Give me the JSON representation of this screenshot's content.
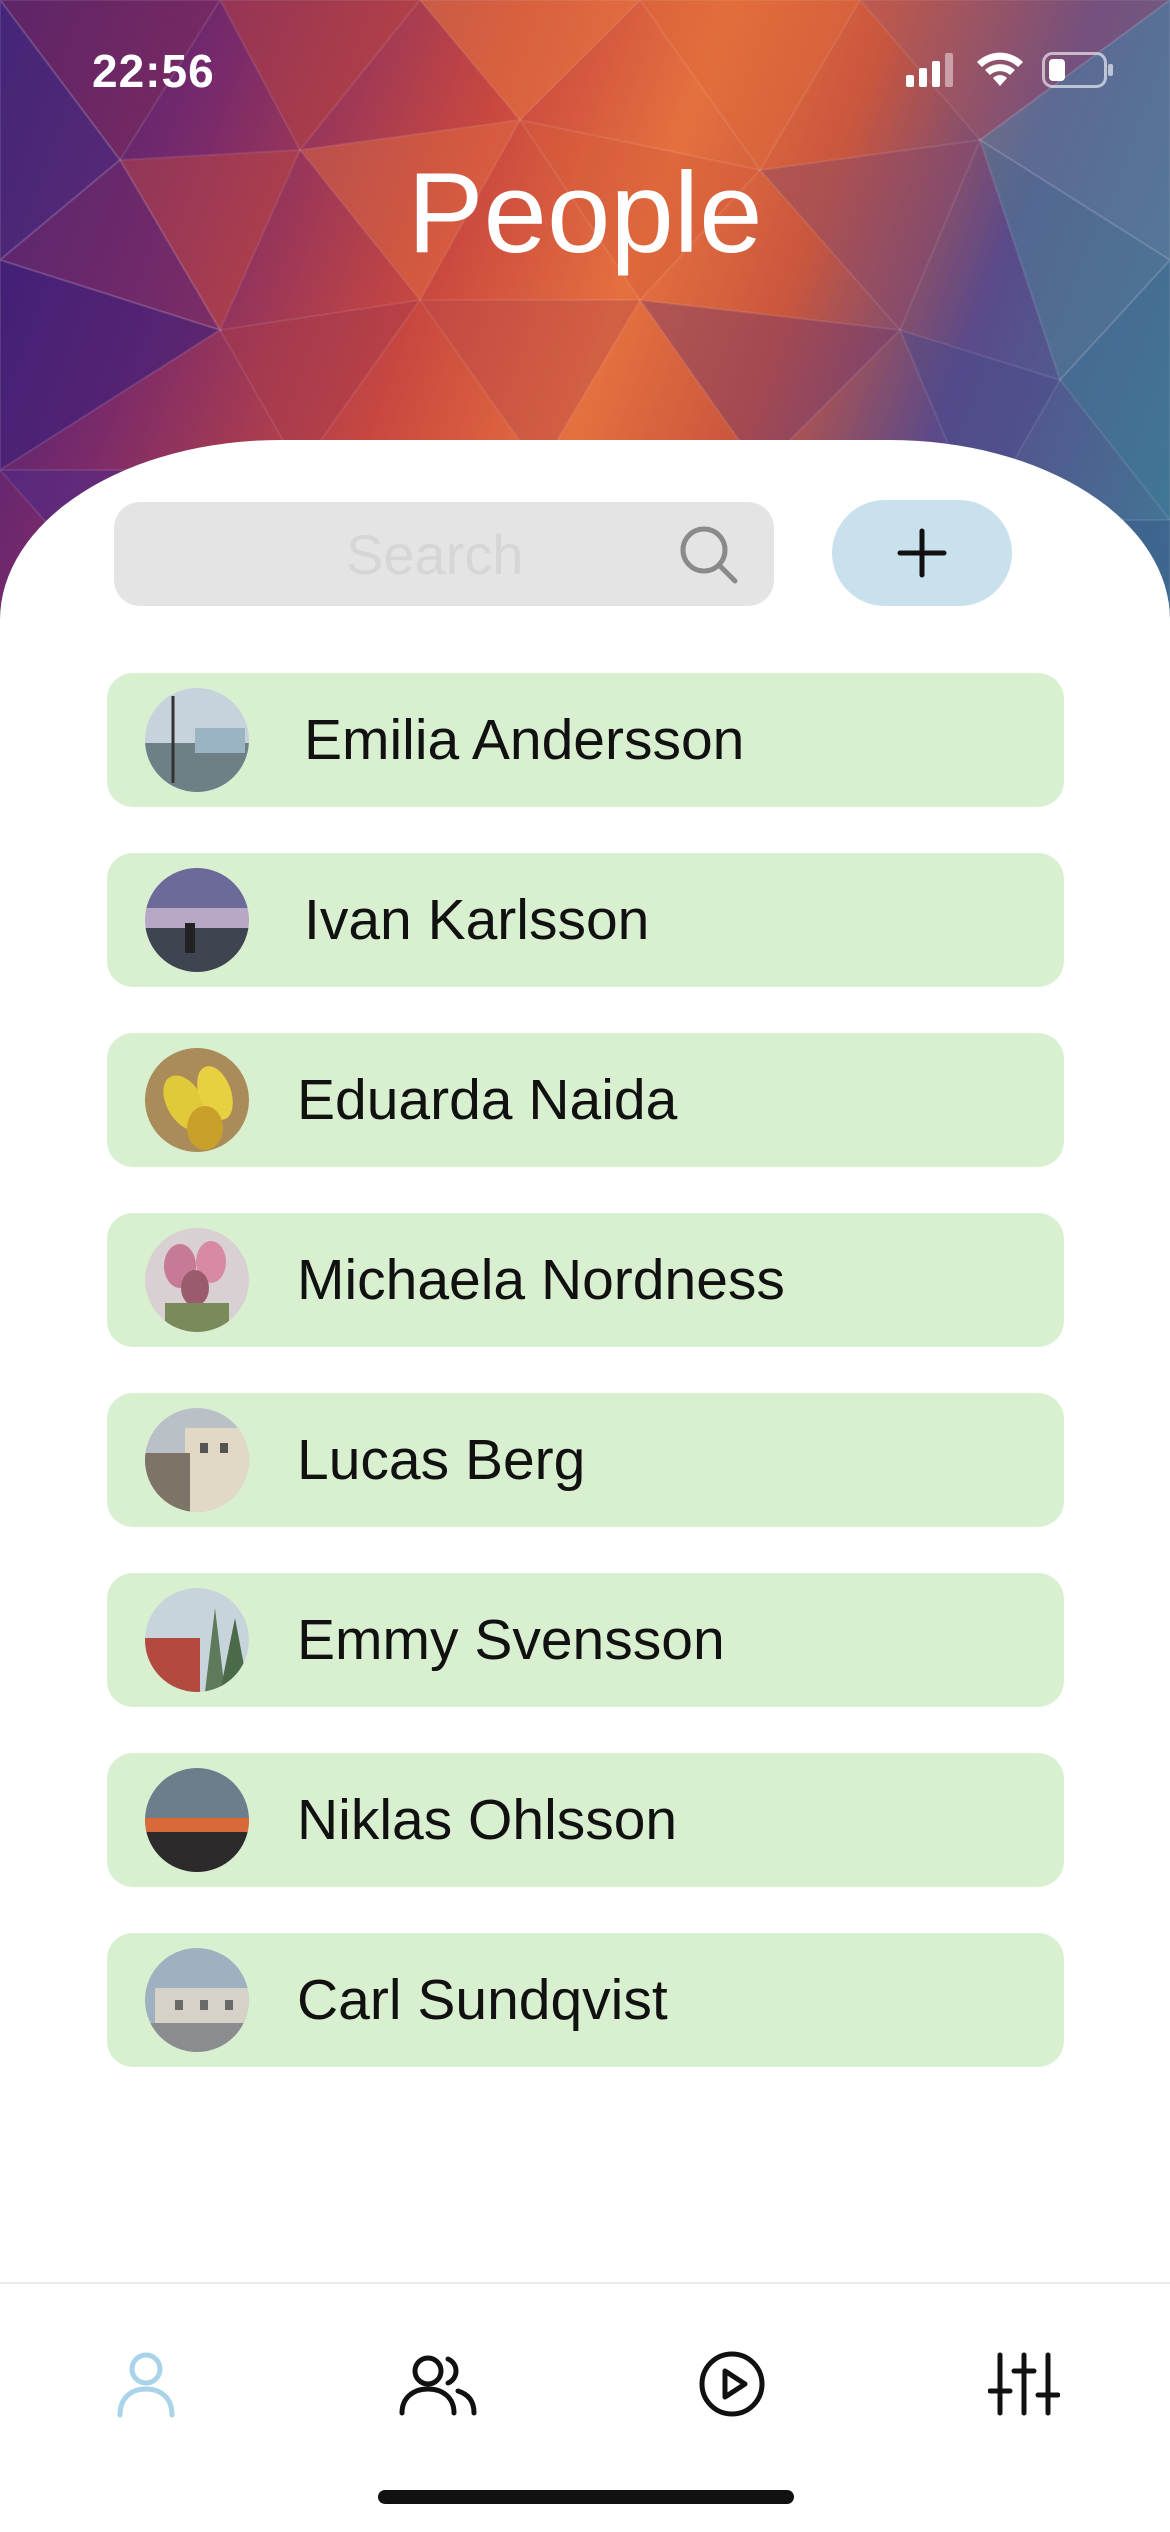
{
  "status_bar": {
    "time": "22:56"
  },
  "header": {
    "title": "People"
  },
  "search": {
    "placeholder": "Search"
  },
  "add_button": {
    "icon": "plus-icon"
  },
  "people": [
    {
      "name": "Emilia Andersson",
      "avatar_colors": [
        "#9bb4c4",
        "#6f7f86",
        "#c6cdd2"
      ]
    },
    {
      "name": "Ivan Karlsson",
      "avatar_colors": [
        "#6c6a9a",
        "#3e4550",
        "#b7a8c8"
      ]
    },
    {
      "name": "Eduarda Naida",
      "avatar_colors": [
        "#e2c93a",
        "#c9a12a",
        "#a98c5a"
      ]
    },
    {
      "name": "Michaela Nordness",
      "avatar_colors": [
        "#c77a95",
        "#9a5c6c",
        "#7a8a5a"
      ]
    },
    {
      "name": "Lucas Berg",
      "avatar_colors": [
        "#b9c0c6",
        "#7d7366",
        "#e2d8c6"
      ]
    },
    {
      "name": "Emmy Svensson",
      "avatar_colors": [
        "#b24a40",
        "#5d7a5a",
        "#c8d4dc"
      ]
    },
    {
      "name": "Niklas Ohlsson",
      "avatar_colors": [
        "#6d7d8c",
        "#d86a3a",
        "#2c2a2a"
      ]
    },
    {
      "name": "Carl Sundqvist",
      "avatar_colors": [
        "#9fb0c0",
        "#8a8c90",
        "#d6d2c8"
      ]
    }
  ],
  "tabs": [
    {
      "icon": "person-icon",
      "active": true
    },
    {
      "icon": "people-icon",
      "active": false
    },
    {
      "icon": "play-icon",
      "active": false
    },
    {
      "icon": "sliders-icon",
      "active": false
    }
  ],
  "colors": {
    "accent": "#a9d3e8",
    "row_background": "#d8f0d0",
    "add_button_background": "#c9e1ec",
    "search_background": "#e4e4e4"
  }
}
